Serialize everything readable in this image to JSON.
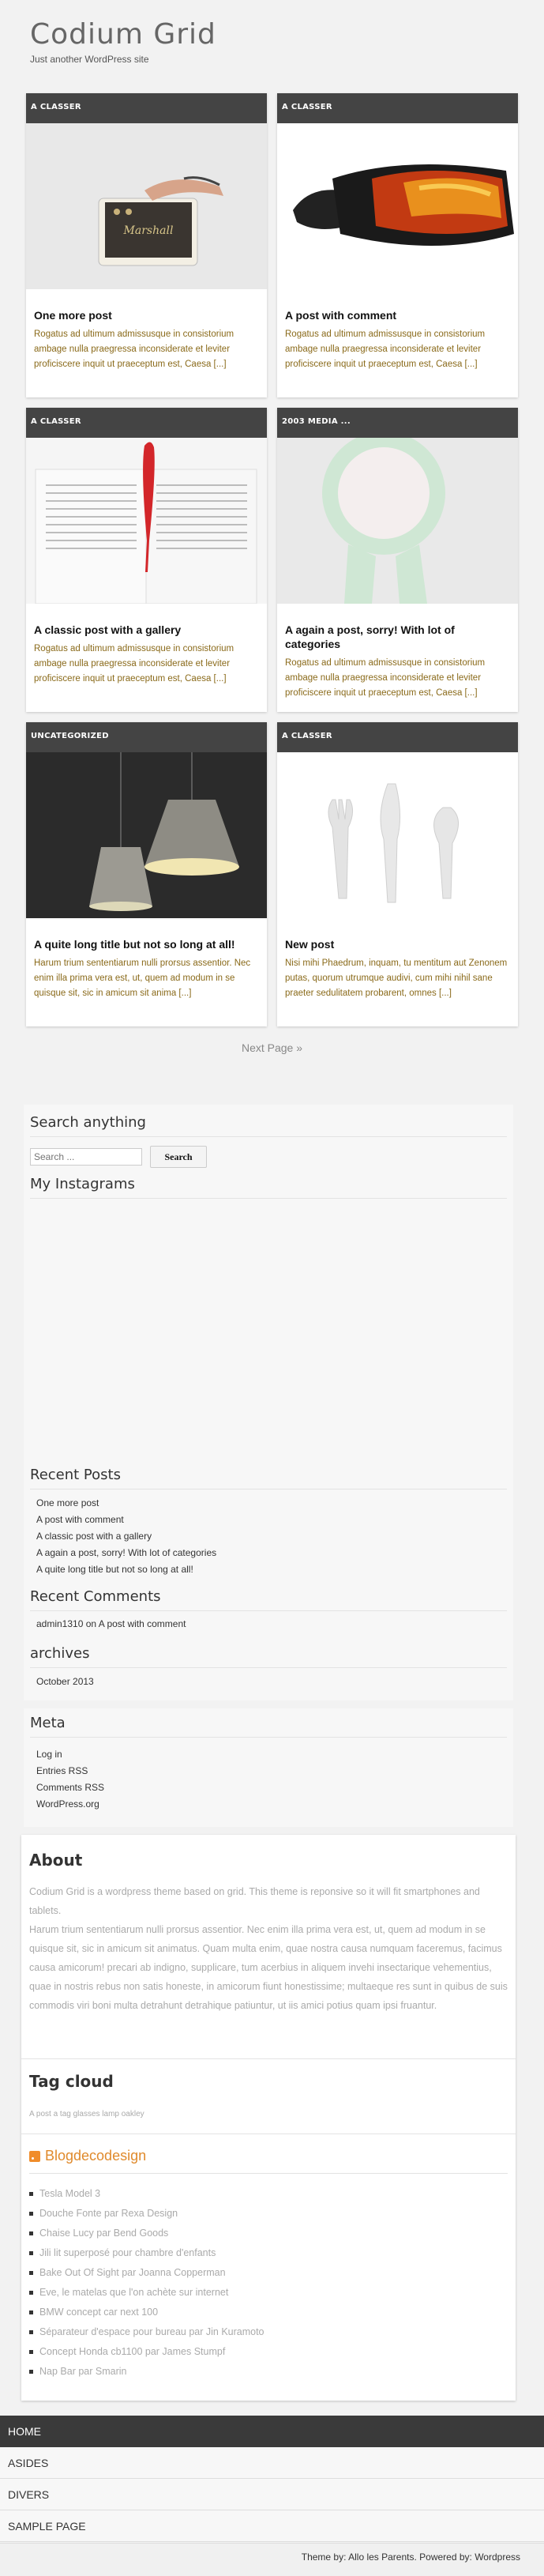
{
  "site": {
    "title": "Codium Grid",
    "description": "Just another WordPress site"
  },
  "posts": [
    {
      "category": "A CLASSER",
      "title": "One more post",
      "excerpt": "Rogatus ad ultimum admissusque in consistorium ambage nulla praegressa inconsiderate et leviter proficiscere inquit ut praeceptum est, Caesa [...]"
    },
    {
      "category": "A CLASSER",
      "title": "A post with comment",
      "excerpt": "Rogatus ad ultimum admissusque in consistorium ambage nulla praegressa inconsiderate et leviter proficiscere inquit ut praeceptum est, Caesa [...]"
    },
    {
      "category": "A CLASSER",
      "title": "A classic post with a gallery",
      "excerpt": "Rogatus ad ultimum admissusque in consistorium ambage nulla praegressa inconsiderate et leviter proficiscere inquit ut praeceptum est, Caesa [...]"
    },
    {
      "category": "2003 MEDIA ...",
      "title": "A again a post, sorry! With lot of categories",
      "excerpt": "Rogatus ad ultimum admissusque in consistorium ambage nulla praegressa inconsiderate et leviter proficiscere inquit ut praeceptum est, Caesa [...]"
    },
    {
      "category": "UNCATEGORIZED",
      "title": "A quite long title but not so long at all!",
      "excerpt": "Harum trium sententiarum nulli prorsus assentior. Nec enim illa prima vera est, ut, quem ad modum in se quisque sit, sic in amicum sit anima [...]"
    },
    {
      "category": "A CLASSER",
      "title": "New post",
      "excerpt": "Nisi mihi Phaedrum, inquam, tu mentitum aut Zenonem putas, quorum utrumque audivi, cum mihi nihil sane praeter sedulitatem probarent, omnes [...]"
    }
  ],
  "pagination": {
    "next": "Next Page »"
  },
  "widgets": {
    "search": {
      "title": "Search anything",
      "placeholder": "Search ...",
      "button": "Search"
    },
    "instagram": {
      "title": "My Instagrams"
    },
    "recent_posts": {
      "title": "Recent Posts",
      "items": [
        "One more post",
        "A post with comment",
        "A classic post with a gallery",
        "A again a post, sorry! With lot of categories",
        "A quite long title but not so long at all!"
      ]
    },
    "recent_comments": {
      "title": "Recent Comments",
      "author": "admin1310",
      "on": "on",
      "post": "A post with comment"
    },
    "archives": {
      "title": "archives",
      "items": [
        "October 2013"
      ]
    },
    "meta": {
      "title": "Meta",
      "items": [
        "Log in",
        "Entries RSS",
        "Comments RSS",
        "WordPress.org"
      ]
    },
    "about": {
      "title": "About",
      "p1": "Codium Grid is a wordpress theme based on grid. This theme is reponsive so it will fit smartphones and tablets.",
      "p2": "Harum trium sententiarum nulli prorsus assentior. Nec enim illa prima vera est, ut, quem ad modum in se quisque sit, sic in amicum sit animatus. Quam multa enim, quae nostra causa numquam faceremus, facimus causa amicorum! precari ab indigno, supplicare, tum acerbius in aliquem invehi insectarique vehementius, quae in nostris rebus non satis honeste, in amicorum fiunt honestissime; multaeque res sunt in quibus de suis commodis viri boni multa detrahunt detrahique patiuntur, ut iis amici potius quam ipsi fruantur."
    },
    "tag_cloud": {
      "title": "Tag cloud",
      "text": "A post a tag glasses lamp oakley"
    },
    "rss": {
      "title": "Blogdecodesign",
      "items": [
        "Tesla Model 3",
        "Douche Fonte par Rexa Design",
        "Chaise Lucy par Bend Goods",
        "Jili lit superposé pour chambre d'enfants",
        "Bake Out Of Sight par Joanna Copperman",
        "Eve, le matelas que l'on achète sur internet",
        "BMW concept car next 100",
        "Séparateur d'espace pour bureau par Jin Kuramoto",
        "Concept Honda cb1100 par James Stumpf",
        "Nap Bar par Smarin"
      ]
    }
  },
  "nav": [
    "HOME",
    "ASIDES",
    "DIVERS",
    "SAMPLE PAGE"
  ],
  "footer": {
    "text": "Theme by: Allo les Parents. Powered by: Wordpress"
  }
}
